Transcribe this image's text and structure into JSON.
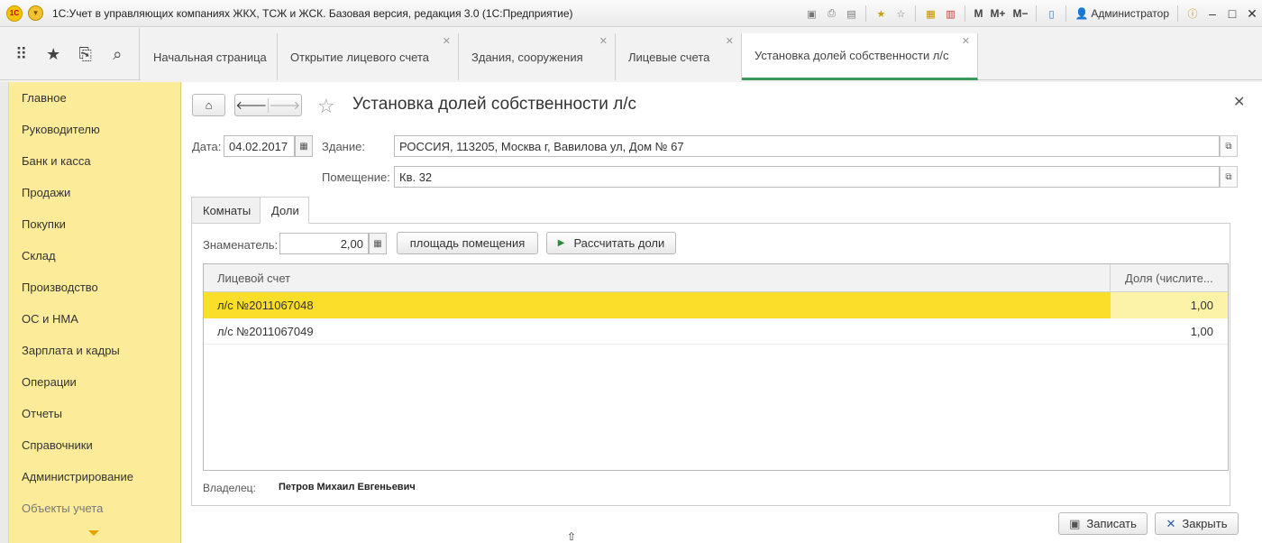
{
  "window": {
    "title": "1С:Учет в управляющих компаниях ЖКХ, ТСЖ и ЖСК. Базовая версия, редакция 3.0  (1С:Предприятие)",
    "user": "Администратор",
    "m_labels": [
      "M",
      "M+",
      "M−"
    ]
  },
  "tabs": [
    {
      "label": "Начальная страница"
    },
    {
      "label": "Открытие лицевого счета"
    },
    {
      "label": "Здания, сооружения"
    },
    {
      "label": "Лицевые счета"
    },
    {
      "label": "Установка долей собственности л/с"
    }
  ],
  "sidebar": {
    "items": [
      "Главное",
      "Руководителю",
      "Банк и касса",
      "Продажи",
      "Покупки",
      "Склад",
      "Производство",
      "ОС и НМА",
      "Зарплата и кадры",
      "Операции",
      "Отчеты",
      "Справочники",
      "Администрирование",
      "Объекты учета"
    ]
  },
  "form": {
    "title": "Установка долей собственности л/с",
    "date_label": "Дата:",
    "date_value": "04.02.2017",
    "building_label": "Здание:",
    "building_value": "РОССИЯ, 113205, Москва г, Вавилова ул, Дом № 67",
    "room_label": "Помещение:",
    "room_value": "Кв. 32",
    "tab_rooms": "Комнаты",
    "tab_shares": "Доли",
    "denominator_label": "Знаменатель:",
    "denominator_value": "2,00",
    "area_button": "площадь помещения",
    "calc_button": "Рассчитать доли",
    "grid": {
      "col1": "Лицевой счет",
      "col2": "Доля (числите...",
      "rows": [
        {
          "account": "л/с №2011067048",
          "share": "1,00",
          "selected": true
        },
        {
          "account": "л/с №2011067049",
          "share": "1,00",
          "selected": false
        }
      ]
    },
    "owner_label": "Владелец:",
    "owner_value": "Петров Михаил Евгеньевич",
    "save_button": "Записать",
    "close_button": "Закрыть"
  }
}
